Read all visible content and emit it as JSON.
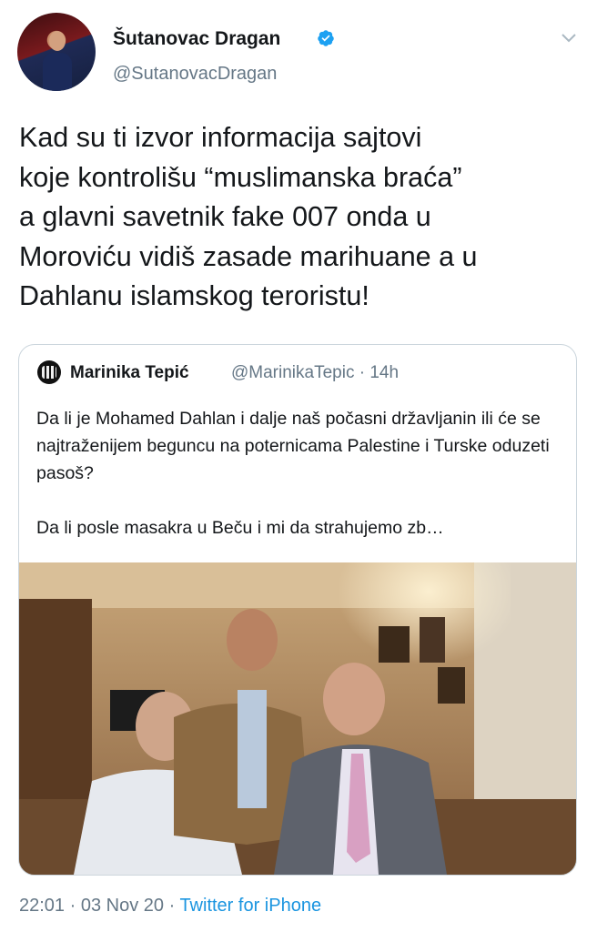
{
  "tweet": {
    "author": {
      "display_name": "Šutanovac Dragan",
      "handle": "@SutanovacDragan",
      "verified": true
    },
    "text": "Kad su ti izvor informacija sajtovi\nkoje kontrolišu “muslimanska braća”\na glavni savetnik fake 007 onda u\nMoroviću vidiš zasade marihuane a u\nDahlanu islamskog teroristu!",
    "quoted": {
      "display_name": "Marinika Tepić",
      "handle_time": "@MarinikaTepic · 14h",
      "paragraph_1": "Da li je Mohamed Dahlan i dalje naš počasni državljanin ili će se najtraženijem beguncu na poternicama Palestine i Turske oduzeti pasoš?",
      "paragraph_2": "Da li posle masakra u Beču i mi da strahujemo zb…"
    },
    "footer": {
      "time": "22:01",
      "date": "03 Nov 20",
      "source": "Twitter for iPhone",
      "separator": " · "
    }
  },
  "colors": {
    "primary_text": "#14171a",
    "secondary_text": "#657786",
    "link": "#1b95e0",
    "verified": "#1da1f2",
    "card_border": "#ccd6dd"
  },
  "icons": [
    "verified-badge-icon",
    "chevron-down-icon"
  ]
}
